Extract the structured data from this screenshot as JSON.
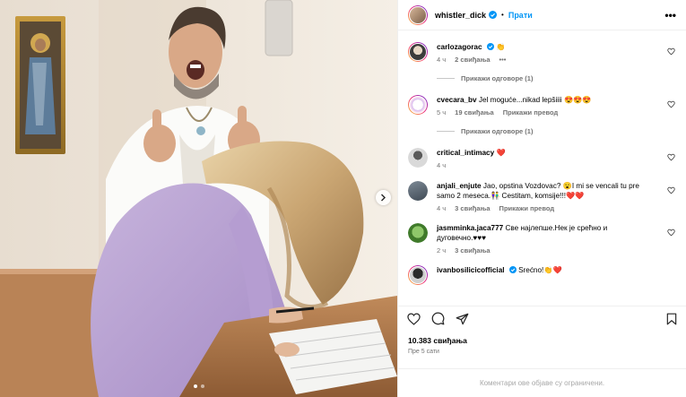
{
  "header": {
    "username": "whistler_dick",
    "separator": "•",
    "follow_label": "Прати",
    "more_label": "•••"
  },
  "comments": [
    {
      "username": "carlozagorac",
      "text": "👏",
      "time": "4 ч",
      "likes": "2 свиђања",
      "more": "•••",
      "verified": true,
      "replies_label": "Прикажи одговоре (1)"
    },
    {
      "username": "cvecara_bv",
      "text": "Jel moguće...nikad lepšiiii 😍😍😍",
      "time": "5 ч",
      "likes": "19 свиђања",
      "translate": "Прикажи превод",
      "replies_label": "Прикажи одговоре (1)"
    },
    {
      "username": "critical_intimacy",
      "text": "❤️",
      "time": "4 ч"
    },
    {
      "username": "anjali_enjute",
      "text": "Jao, opstina Vozdovac? 😮I mi se vencali tu pre samo 2 meseca.👫 Cestitam, komsije!!!❤️❤️",
      "time": "4 ч",
      "likes": "3 свиђања",
      "translate": "Прикажи превод"
    },
    {
      "username": "jasmminka.jaca777",
      "text": "Све најлепше.Нек је срећно и дуговечно.♥♥♥",
      "time": "2 ч",
      "likes": "3 свиђања"
    },
    {
      "username": "ivanbosilicicofficial",
      "text": "Srećno!👏❤️",
      "verified": true
    }
  ],
  "likes_count": "10.383 свиђања",
  "posted_ago": "Пре 5 сати",
  "comments_disabled": "Коментари ове објаве су ограничени.",
  "icons": {
    "like": "heart-icon",
    "comment": "comment-icon",
    "share": "share-icon",
    "save": "bookmark-icon",
    "next": "chevron-right-icon"
  },
  "colors": {
    "accent": "#0095f6",
    "verified": "#0095f6",
    "muted": "#737373",
    "like_red": "#ed4956"
  }
}
